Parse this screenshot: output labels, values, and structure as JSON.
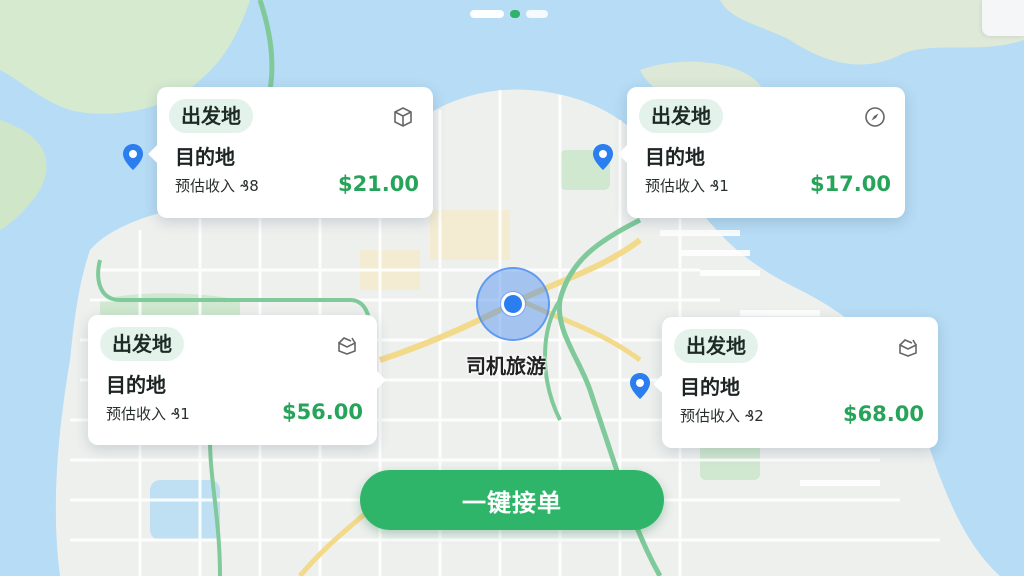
{
  "driver": {
    "label": "司机旅游"
  },
  "accept_button": {
    "label": "一键接单"
  },
  "orders": [
    {
      "origin": "出发地",
      "destination": "目的地",
      "estimate": "预估收入 ₰8",
      "price": "$21.00",
      "icon": "package-icon"
    },
    {
      "origin": "出发地",
      "destination": "目的地",
      "estimate": "预估收入 ₰1",
      "price": "$17.00",
      "icon": "compass-icon"
    },
    {
      "origin": "出发地",
      "destination": "目的地",
      "estimate": "预估收入 ₰1",
      "price": "$56.00",
      "icon": "open-box-icon"
    },
    {
      "origin": "出发地",
      "destination": "目的地",
      "estimate": "预估收入 ₰2",
      "price": "$68.00",
      "icon": "open-box-icon"
    }
  ],
  "pager": {
    "active_index": 1
  },
  "colors": {
    "accent": "#2eb56a",
    "price": "#27a35a",
    "water": "#b7dcf5",
    "land": "#eef0ee",
    "park": "#cfe8cf",
    "driver": "#2a7ef0"
  }
}
